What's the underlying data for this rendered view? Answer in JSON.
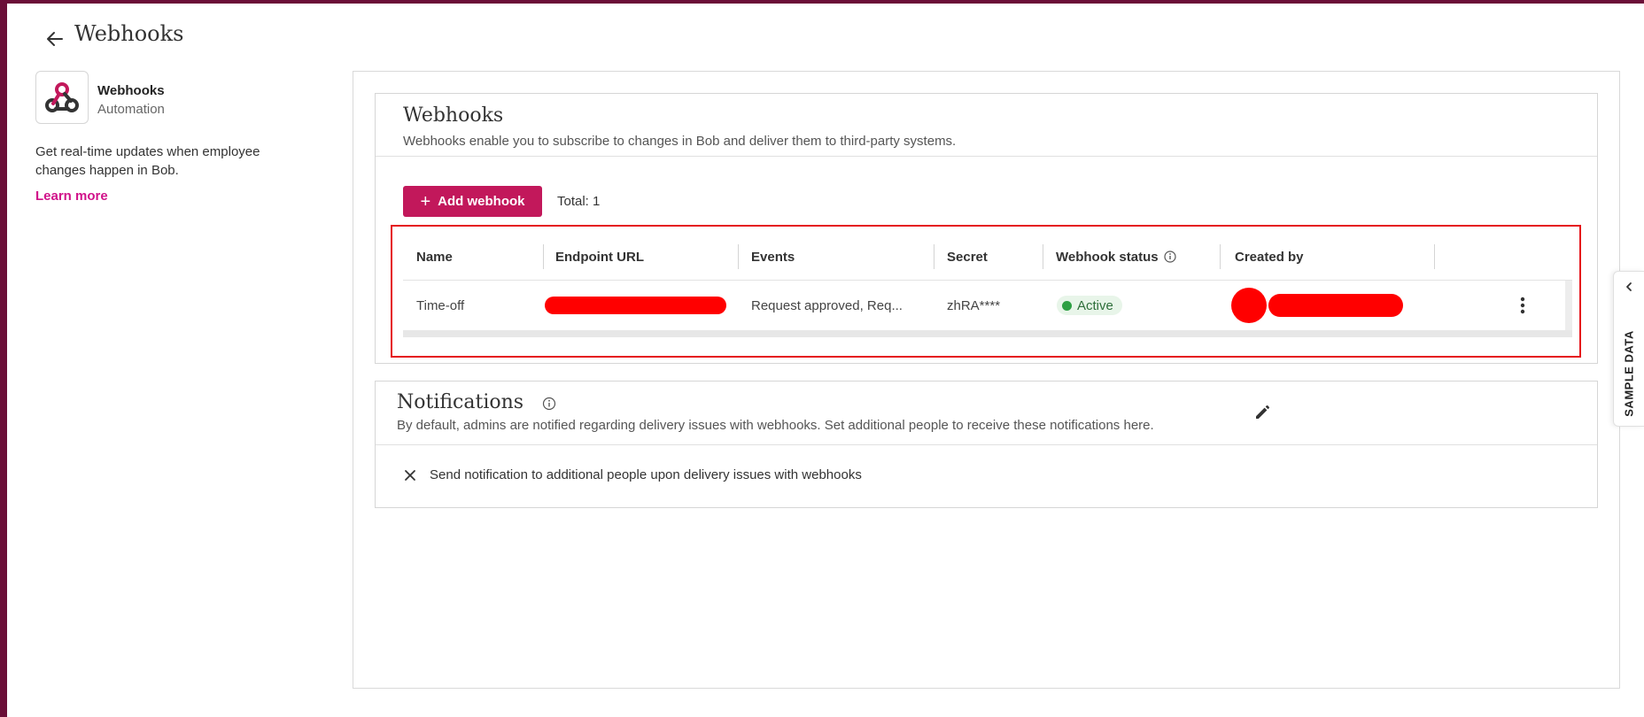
{
  "header": {
    "title": "Webhooks"
  },
  "app": {
    "name": "Webhooks",
    "category": "Automation",
    "description": "Get real-time updates when employee changes happen in Bob.",
    "learn_more": "Learn more"
  },
  "webhooks": {
    "title": "Webhooks",
    "description": "Webhooks enable you to subscribe to changes in Bob and deliver them to third-party systems.",
    "add_button": "Add webhook",
    "total": "Total: 1",
    "columns": [
      "Name",
      "Endpoint URL",
      "Events",
      "Secret",
      "Webhook status",
      "Created by"
    ],
    "rows": [
      {
        "name": "Time-off",
        "events": "Request approved, Req...",
        "secret": "zhRA****",
        "status": "Active"
      }
    ]
  },
  "notifications": {
    "title": "Notifications",
    "description": "By default, admins are notified regarding delivery issues with webhooks. Set additional people to receive these notifications here.",
    "option": "Send notification to additional people upon delivery issues with webhooks"
  },
  "side_tab": {
    "label": "SAMPLE DATA"
  },
  "colors": {
    "accent": "#c2185b",
    "link": "#d1128a",
    "frame": "#6b0f38",
    "status_active": "#2ea043",
    "redaction": "#ff0000"
  }
}
